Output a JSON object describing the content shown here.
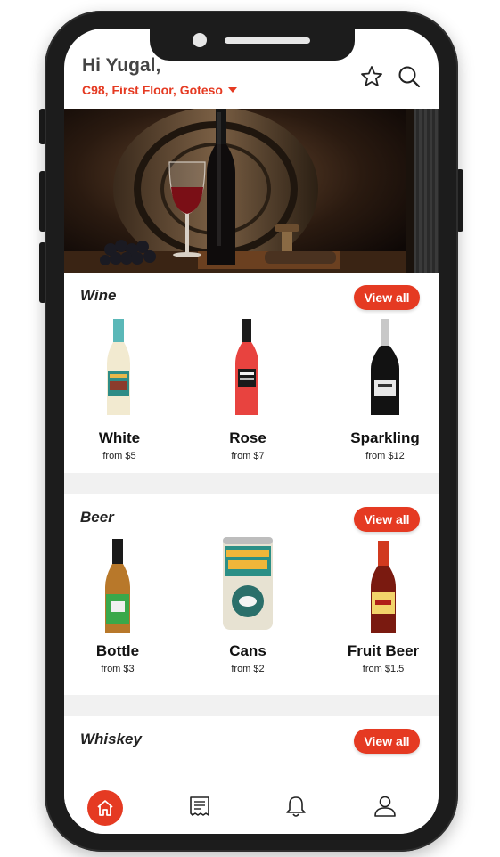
{
  "header": {
    "greeting": "Hi Yugal,",
    "location": "C98, First Floor, Goteso",
    "icons": [
      "star-icon",
      "search-icon"
    ]
  },
  "sections": [
    {
      "title": "Wine",
      "view_all": "View all",
      "items": [
        {
          "name": "White",
          "price": "from $5"
        },
        {
          "name": "Rose",
          "price": "from $7"
        },
        {
          "name": "Sparkling",
          "price": "from $12"
        }
      ]
    },
    {
      "title": "Beer",
      "view_all": "View all",
      "items": [
        {
          "name": "Bottle",
          "price": "from $3"
        },
        {
          "name": "Cans",
          "price": "from $2"
        },
        {
          "name": "Fruit Beer",
          "price": "from $1.5"
        }
      ]
    },
    {
      "title": "Whiskey",
      "view_all": "View all"
    }
  ],
  "bottom_nav": [
    "home-icon",
    "orders-icon",
    "bell-icon",
    "profile-icon"
  ],
  "colors": {
    "accent": "#e53a22",
    "text": "#444444",
    "separator": "#f1f1f1"
  }
}
